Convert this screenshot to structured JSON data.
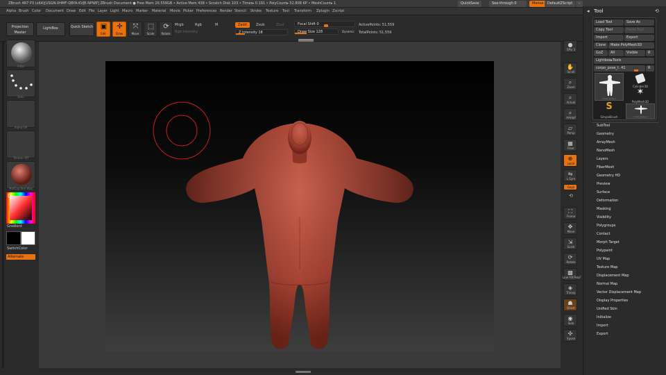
{
  "titlebar": {
    "title": "ZBrush 4R7 P3 (x64)[USGN-XHMF-QBYA-KVJE-NPWP]    ZBrush Document         ● Free Mem 26.558GB • Active Mem 438 • Scratch Disk 103 • Timer▸ 0.191 • PolyCount▸ 52.808 KP • MeshCount▸ 1",
    "quicksave": "QuickSave",
    "see_through": "See-through  0",
    "menus_label": "Menus",
    "default_zscript": "DefaultZScript"
  },
  "menubar": [
    "Alpha",
    "Brush",
    "Color",
    "Document",
    "Draw",
    "Edit",
    "File",
    "Layer",
    "Light",
    "Macro",
    "Marker",
    "Material",
    "Movie",
    "Picker",
    "Preferences",
    "Render",
    "Stencil",
    "Stroke",
    "Texture",
    "Tool",
    "Transform",
    "Zplugin",
    "Zscript"
  ],
  "toolbar": {
    "projection_master": "Projection Master",
    "lightbox": "LightBox",
    "quick_sketch": "Quick Sketch",
    "edit": "Edit",
    "draw": "Draw",
    "move": "Move",
    "scale": "Scale",
    "rotate": "Rotate",
    "mrgb": "Mrgb",
    "rgb": "Rgb",
    "m": "M",
    "rgb_intensity": "Rgb Intensity",
    "zadd": "Zadd",
    "zsub": "Zsub",
    "zcut": "Zcut",
    "z_intensity": "Z Intensity 18",
    "focal_shift": "Focal Shift 0",
    "draw_size": "Draw Size 128",
    "dynamic": "Dynamic",
    "active_points": "ActivePoints: 51,559",
    "total_points": "TotalPoints: 51,559"
  },
  "leftshelf": {
    "brush_label": "Inflat",
    "stroke_label": "Dots",
    "alpha_label": "Alpha Off",
    "texture_label": "Texture Off",
    "material_label": "MatCap Red Wax",
    "gradient": "Gradient",
    "switch_color": "SwitchColor",
    "alternate": "Alternate"
  },
  "rightshelf": [
    "SPix 3",
    "Scroll",
    "Zoom",
    "Actual",
    "AAHalf",
    "Persp",
    "Floor",
    "Local",
    "L.Sym",
    "Gxyz",
    "Frame",
    "Move",
    "Scale",
    "Rotate",
    "Line Fill PolyF",
    "Transp",
    "Ghost",
    "Solo",
    "Xpose"
  ],
  "toolpanel": {
    "title": "Tool",
    "load_tool": "Load Tool",
    "save_as": "Save As",
    "copy_tool": "Copy Tool",
    "paste_tool": "Paste Tool",
    "import": "Import",
    "export": "Export",
    "clone": "Clone",
    "make_polymesh": "Make PolyMesh3D",
    "goz": "GoZ",
    "all": "All",
    "visible": "Visible",
    "r": "R",
    "lightbox_tools": "Lightbox▸Tools",
    "current_tool": "corpo_pose_t. 41",
    "thumbs": [
      "corpo_pose_t",
      "Cylinder3D",
      "PolyMesh3D",
      "SimpleBrush",
      "corpo_pose_t"
    ],
    "subpalettes": [
      "SubTool",
      "Geometry",
      "ArrayMesh",
      "NanoMesh",
      "Layers",
      "FiberMesh",
      "Geometry HD",
      "Preview",
      "Surface",
      "Deformation",
      "Masking",
      "Visibility",
      "Polygroups",
      "Contact",
      "Morph Target",
      "Polypaint",
      "UV Map",
      "Texture Map",
      "Displacement Map",
      "Normal Map",
      "Vector Displacement Map",
      "Display Properties",
      "Unified Skin",
      "Initialize",
      "Import",
      "Export"
    ]
  },
  "colors": {
    "accent": "#e8720c",
    "model": "#b04a3a",
    "cursor": "#c81e1e"
  }
}
